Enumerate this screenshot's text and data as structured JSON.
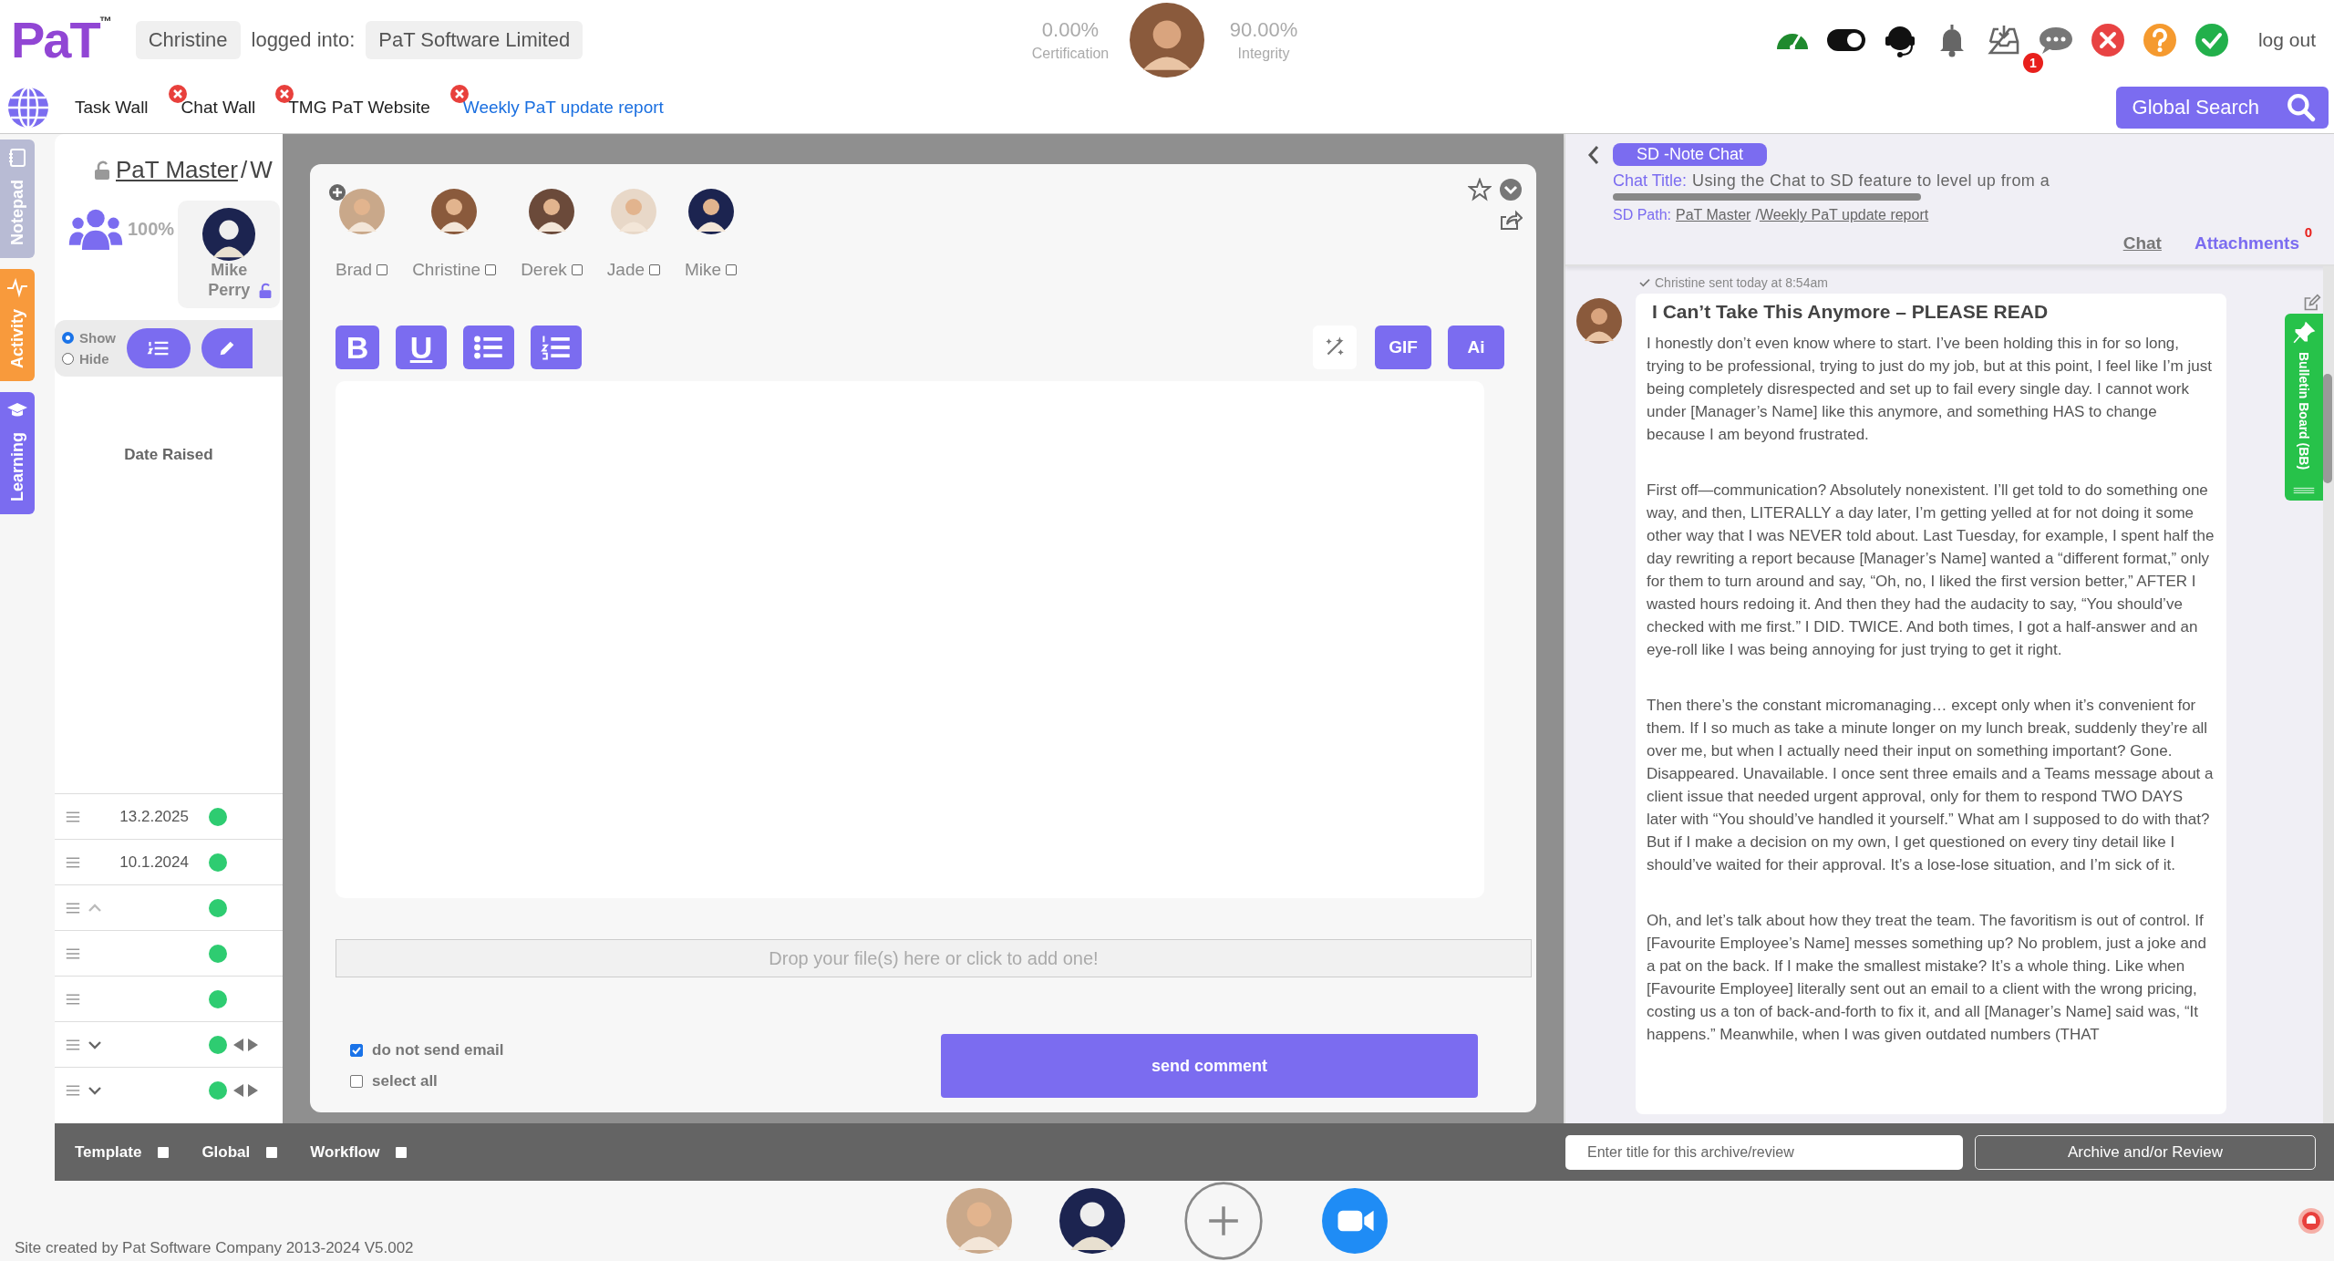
{
  "header": {
    "logo": "PaT",
    "logo_mark": "™",
    "user": "Christine",
    "logged_into_label": "logged into:",
    "company": "PaT Software Limited",
    "stats": [
      {
        "value": "0.00%",
        "label": "Certification"
      },
      {
        "value": "90.00%",
        "label": "Integrity"
      }
    ],
    "icons": [
      {
        "kind": "gauge"
      },
      {
        "kind": "toggle",
        "on": true
      },
      {
        "kind": "headset"
      },
      {
        "kind": "bell"
      },
      {
        "kind": "inbox"
      },
      {
        "kind": "chat",
        "badge": "1"
      },
      {
        "kind": "close"
      },
      {
        "kind": "help"
      },
      {
        "kind": "check"
      }
    ],
    "logout": "log out"
  },
  "tabs": [
    {
      "label": "Task Wall",
      "closable": false,
      "selected": false
    },
    {
      "label": "Chat Wall",
      "closable": true,
      "selected": false
    },
    {
      "label": "TMG PaT Website",
      "closable": true,
      "selected": false
    },
    {
      "label": "Weekly PaT update report",
      "closable": true,
      "selected": true
    }
  ],
  "global_search": {
    "label": "Global Search"
  },
  "side_tabs": [
    {
      "kind": "notepad",
      "label": "Notepad",
      "color": "#b8bbd4"
    },
    {
      "kind": "activity",
      "label": "Activity",
      "color": "#f89a3c"
    },
    {
      "kind": "learning",
      "label": "Learning",
      "color": "#7b6cf0"
    }
  ],
  "left_panel": {
    "path_root": "PaT Master",
    "separator": "/",
    "path_rest": "W",
    "percent": "100%",
    "member": "Mike Perry",
    "visibility": [
      {
        "label": "Show",
        "selected": true
      },
      {
        "label": "Hide",
        "selected": false
      }
    ],
    "column_header": "Date Raised",
    "rows": [
      {
        "kind": "plain",
        "date": "13.2.2025",
        "arrows": false
      },
      {
        "kind": "plain",
        "date": "10.1.2024",
        "arrows": false
      },
      {
        "kind": "collapse",
        "arrows": false
      },
      {
        "kind": "plain",
        "arrows": false
      },
      {
        "kind": "plain",
        "arrows": false
      },
      {
        "kind": "expand",
        "arrows": true
      },
      {
        "kind": "expand",
        "arrows": true
      }
    ]
  },
  "composer": {
    "participants": [
      {
        "name": "Brad",
        "checked": false
      },
      {
        "name": "Christine",
        "checked": false
      },
      {
        "name": "Derek",
        "checked": false
      },
      {
        "name": "Jade",
        "checked": false
      },
      {
        "name": "Mike",
        "checked": false
      }
    ],
    "format_buttons": [
      {
        "kind": "bold",
        "label": "B"
      },
      {
        "kind": "underline",
        "label": "U"
      },
      {
        "kind": "bullets"
      },
      {
        "kind": "numbered"
      }
    ],
    "tools": [
      {
        "kind": "sparkle"
      },
      {
        "kind": "text",
        "label": "GIF"
      },
      {
        "kind": "text",
        "label": "Ai"
      }
    ],
    "dropzone": "Drop your file(s) here or click to add one!",
    "options": [
      {
        "label": "do not send email",
        "checked": true
      },
      {
        "label": "select all",
        "checked": false
      }
    ],
    "send_label": "send comment"
  },
  "chat": {
    "pill": "SD -Note Chat",
    "title_label": "Chat Title:",
    "title": "Using the Chat to SD feature to level up from a",
    "path_label": "SD Path:",
    "path_root": "PaT Master",
    "separator": "/",
    "path_leaf": "Weekly PaT update report",
    "tabs": [
      {
        "label": "Chat",
        "selected": true
      },
      {
        "label": "Attachments",
        "selected": false,
        "badge": "0"
      }
    ],
    "message": {
      "sender_note": "Christine sent today at 8:54am",
      "title": "I Can’t Take This Anymore – PLEASE READ",
      "paragraphs": [
        "I honestly don’t even know where to start. I’ve been holding this in for so long, trying to be professional, trying to just do my job, but at this point, I feel like I’m just being completely disrespected and set up to fail every single day. I cannot work under [Manager’s Name] like this anymore, and something HAS to change because I am beyond frustrated.",
        "First off—communication? Absolutely nonexistent. I’ll get told to do something one way, and then, LITERALLY a day later, I’m getting yelled at for not doing it some other way that I was NEVER told about. Last Tuesday, for example, I spent half the day rewriting a report because [Manager’s Name] wanted a “different format,” only for them to turn around and say, “Oh, no, I liked the first version better,” AFTER I wasted hours redoing it. And then they had the audacity to say, “You should’ve checked with me first.” I DID. TWICE. And both times, I got a half-answer and an eye-roll like I was being annoying for just trying to get it right.",
        "Then there’s the constant micromanaging… except only when it’s convenient for them. If I so much as take a minute longer on my lunch break, suddenly they’re all over me, but when I actually need their input on something important? Gone. Disappeared. Unavailable. I once sent three emails and a Teams message about a client issue that needed urgent approval, only for them to respond TWO DAYS later with “You should’ve handled it yourself.” What am I supposed to do with that? But if I make a decision on my own, I get questioned on every tiny detail like I should’ve waited for their approval. It’s a lose-lose situation, and I’m sick of it.",
        "Oh, and let’s talk about how they treat the team. The favoritism is out of control. If [Favourite Employee’s Name] messes something up? No problem, just a joke and a pat on the back. If I make the smallest mistake? It’s a whole thing. Like when [Favourite Employee] literally sent out an email to a client with the wrong pricing, costing us a ton of back-and-forth to fix it, and all [Manager’s Name] said was, “It happens.” Meanwhile, when I was given outdated numbers (THAT"
      ]
    },
    "bulletin": "Bulletin Board (BB)"
  },
  "bottom_bar": {
    "options": [
      {
        "label": "Template",
        "checked": false
      },
      {
        "label": "Global",
        "checked": false
      },
      {
        "label": "Workflow",
        "checked": false
      }
    ],
    "archive_placeholder": "Enter title for this archive/review",
    "archive_button": "Archive and/or Review"
  },
  "footer": {
    "credit": "Site created by Pat Software Company 2013-2024 V5.002"
  }
}
